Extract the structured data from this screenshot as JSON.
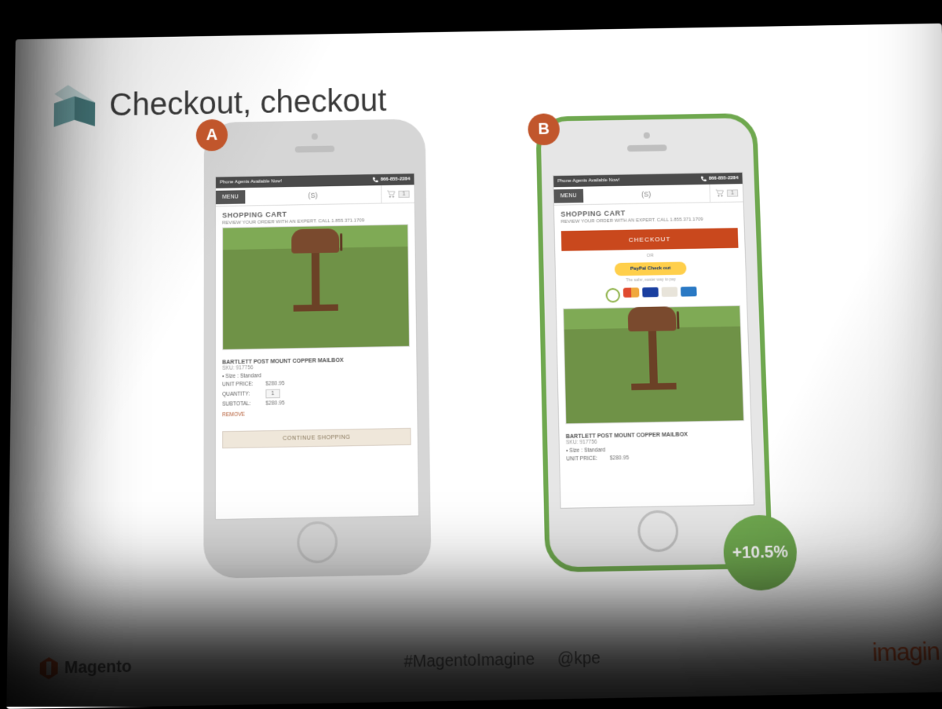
{
  "slide": {
    "title": "Checkout, checkout",
    "variant_a_label": "A",
    "variant_b_label": "B",
    "result_uplift": "+10.5%"
  },
  "footer": {
    "brand": "Magento",
    "hashtag": "#MagentoImagine",
    "handle": "@kpe",
    "event": "imagin"
  },
  "topbar": {
    "agents_text": "Phone Agents Available Now!",
    "phone_number": "866-855-2284"
  },
  "header": {
    "menu_label": "MENU",
    "brand_mark": "(S)",
    "cart_count": "1"
  },
  "cart": {
    "heading": "SHOPPING CART",
    "review_line": "REVIEW YOUR ORDER WITH AN EXPERT. CALL 1.855.371.1709",
    "checkout_label": "CHECKOUT",
    "or_label": "OR",
    "paypal_label": "PayPal Check out",
    "safe_line": "The safer, easier way to pay",
    "product_name": "BARTLETT POST MOUNT COPPER MAILBOX",
    "sku_label": "SKU: 917756",
    "size_label": "Size : Standard",
    "unit_price_label": "UNIT PRICE:",
    "unit_price_value": "$280.95",
    "quantity_label": "QUANTITY:",
    "quantity_value": "1",
    "subtotal_label": "SUBTOTAL:",
    "subtotal_value": "$280.95",
    "remove_label": "REMOVE",
    "continue_label": "CONTINUE SHOPPING"
  },
  "payment_icons": {
    "authorize": "#8fb24a",
    "mastercard": "#d8d8d8",
    "visa": "#1a3fa0",
    "discover": "#e08a3d",
    "amex": "#2a79c4"
  }
}
